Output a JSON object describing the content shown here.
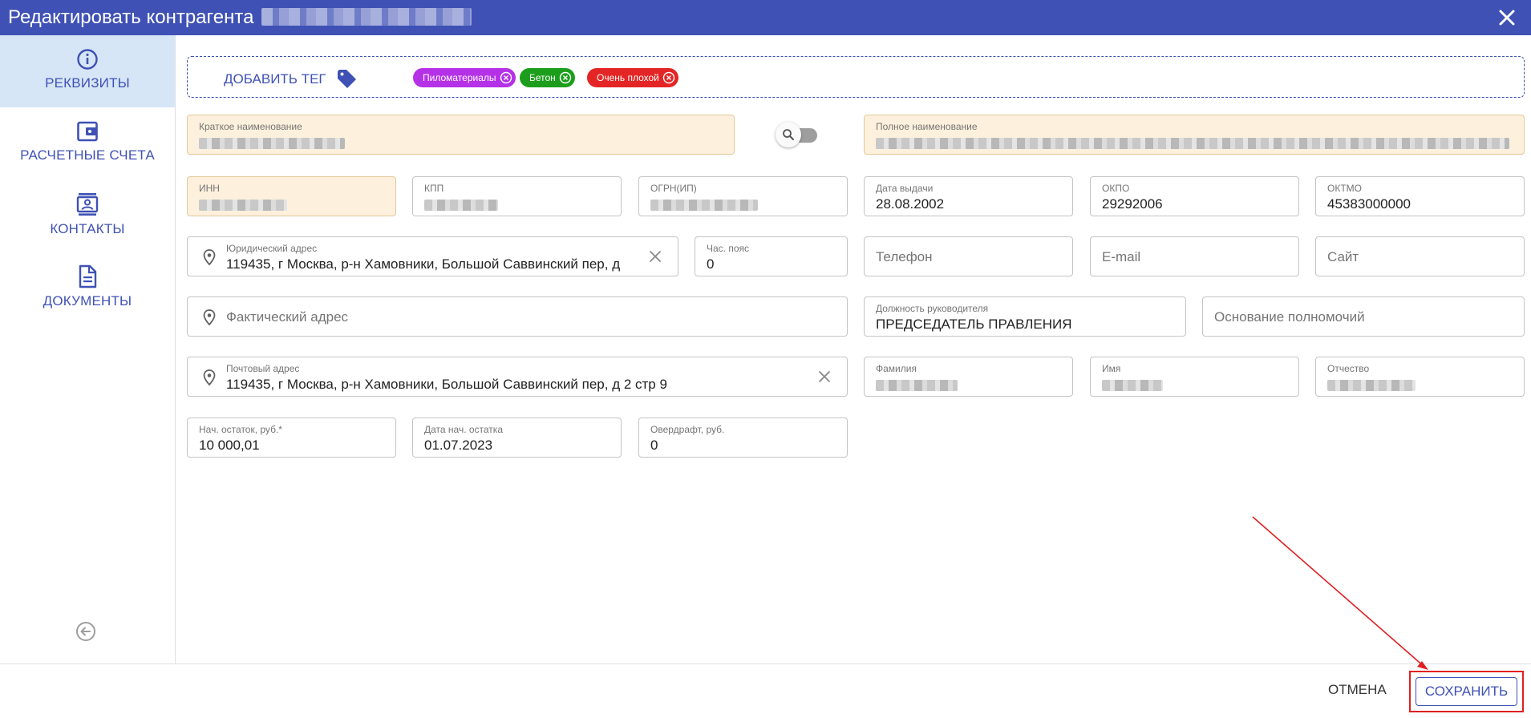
{
  "window": {
    "title": "Редактировать контрагента"
  },
  "sidebar": {
    "items": [
      {
        "label": "РЕКВИЗИТЫ",
        "icon": "info-icon",
        "active": true
      },
      {
        "label": "РАСЧЕТНЫЕ СЧЕТА",
        "icon": "wallet-icon",
        "active": false
      },
      {
        "label": "КОНТАКТЫ",
        "icon": "contact-card-icon",
        "active": false
      },
      {
        "label": "ДОКУМЕНТЫ",
        "icon": "document-icon",
        "active": false
      }
    ]
  },
  "tags": {
    "add_label": "ДОБАВИТЬ ТЕГ",
    "items": [
      {
        "label": "Пиломатериалы",
        "color": "#b531e8"
      },
      {
        "label": "Бетон",
        "color": "#1c9e1c"
      },
      {
        "label": "Очень плохой",
        "color": "#e42525"
      }
    ]
  },
  "form": {
    "short_name": {
      "label": "Краткое наименование"
    },
    "full_name": {
      "label": "Полное наименование"
    },
    "inn": {
      "label": "ИНН"
    },
    "kpp": {
      "label": "КПП"
    },
    "ogrn": {
      "label": "ОГРН(ИП)"
    },
    "issue_date": {
      "label": "Дата выдачи",
      "value": "28.08.2002"
    },
    "okpo": {
      "label": "ОКПО",
      "value": "29292006"
    },
    "oktmo": {
      "label": "ОКТМО",
      "value": "45383000000"
    },
    "legal_address": {
      "label": "Юридический адрес",
      "value": "119435, г Москва, р-н Хамовники, Большой Саввинский пер, д"
    },
    "timezone": {
      "label": "Час. пояс",
      "value": "0"
    },
    "phone": {
      "placeholder": "Телефон"
    },
    "email": {
      "placeholder": "E-mail"
    },
    "site": {
      "placeholder": "Сайт"
    },
    "actual_address": {
      "placeholder": "Фактический адрес"
    },
    "head_position": {
      "label": "Должность руководителя",
      "value": "ПРЕДСЕДАТЕЛЬ ПРАВЛЕНИЯ"
    },
    "authority_basis": {
      "placeholder": "Основание полномочий"
    },
    "postal_address": {
      "label": "Почтовый адрес",
      "value": "119435, г Москва, р-н Хамовники, Большой Саввинский пер, д 2 стр 9"
    },
    "last_name": {
      "label": "Фамилия"
    },
    "first_name": {
      "label": "Имя"
    },
    "middle_name": {
      "label": "Отчество"
    },
    "opening_balance": {
      "label": "Нач. остаток, руб.*",
      "value": "10 000,01"
    },
    "opening_balance_date": {
      "label": "Дата нач. остатка",
      "value": "01.07.2023"
    },
    "overdraft": {
      "label": "Овердрафт, руб.",
      "value": "0"
    }
  },
  "footer": {
    "cancel_label": "ОТМЕНА",
    "save_label": "СОХРАНИТЬ"
  },
  "colors": {
    "primary": "#3f51b5",
    "highlight": "#fdf0dc",
    "annotation": "#e02020"
  }
}
